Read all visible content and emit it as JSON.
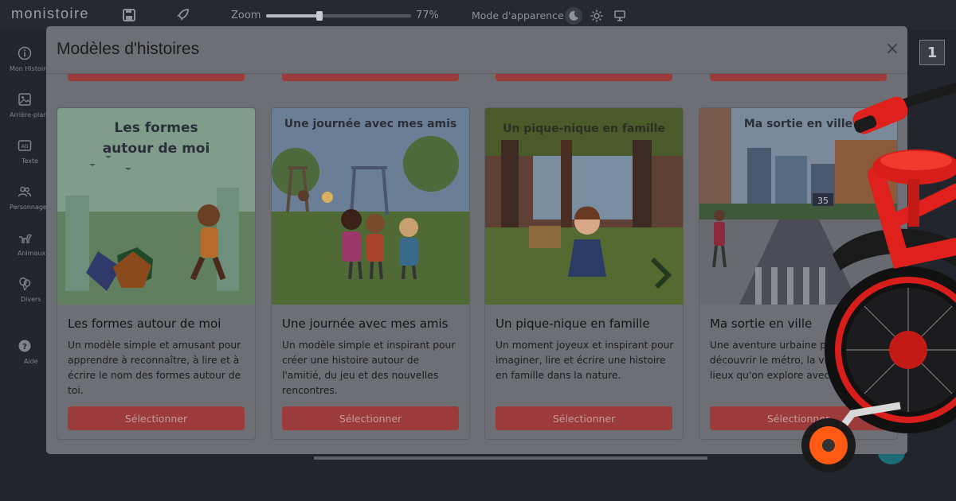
{
  "app": {
    "brand": "monistoire"
  },
  "toolbar": {
    "zoom_label": "Zoom",
    "zoom_value": "77%",
    "zoom_fraction": 0.37,
    "appearance_label": "Mode d'apparence :"
  },
  "sidebar": {
    "items": [
      {
        "label": "Mon Histoire",
        "icon": "info-circle-icon"
      },
      {
        "label": "Arrière-plan",
        "icon": "image-icon"
      },
      {
        "label": "Texte",
        "icon": "text-box-icon"
      },
      {
        "label": "Personnages",
        "icon": "people-icon"
      },
      {
        "label": "Animaux",
        "icon": "dog-icon"
      },
      {
        "label": "Divers",
        "icon": "balloons-icon"
      },
      {
        "label": "Aide",
        "icon": "help-icon"
      }
    ]
  },
  "page_badge": "1",
  "modal": {
    "title": "Modèles d'histoires",
    "close": "×",
    "cards": [
      {
        "image_title_line1": "Les formes",
        "image_title_line2": "autour de moi",
        "title": "Les formes autour de moi",
        "description": "Un modèle simple et amusant pour apprendre à reconnaître, à lire et à écrire le nom des formes autour de toi.",
        "button": "Sélectionner"
      },
      {
        "image_title_line1": "Une journée avec mes amis",
        "title": "Une journée avec mes amis",
        "description": "Un modèle simple et inspirant pour créer une histoire autour de l'amitié, du jeu et des nouvelles rencontres.",
        "button": "Sélectionner"
      },
      {
        "image_title_line1": "Un pique-nique en famille",
        "title": "Un pique-nique en famille",
        "description": "Un moment joyeux et inspirant pour imaginer, lire et écrire une histoire en famille dans la nature.",
        "button": "Sélectionner"
      },
      {
        "image_title_line1": "Ma sortie en ville",
        "street_sign": "35",
        "title": "Ma sortie en ville",
        "description": "Une aventure urbaine pour découvrir le métro, la ville et les lieux qu'on explore avec maman.",
        "button": "Sélectionner"
      }
    ]
  },
  "colors": {
    "button_red": "#9b3b3b",
    "modal_bg": "#6d6f74",
    "bike_red": "#e0201c"
  }
}
